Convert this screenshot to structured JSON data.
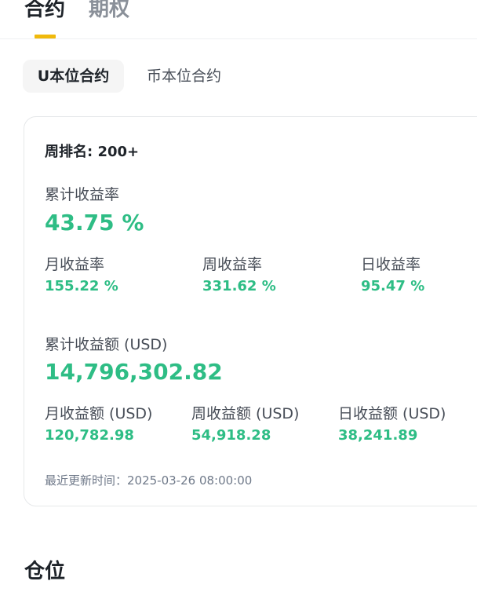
{
  "top_tabs": {
    "active": "合约",
    "inactive": "期权"
  },
  "sub_tabs": {
    "active": "U本位合约",
    "inactive": "币本位合约"
  },
  "card": {
    "rank": "周排名: 200+",
    "cumulative_rate": {
      "label": "累计收益率",
      "value": "43.75 %"
    },
    "rates": [
      {
        "label": "月收益率",
        "value": "155.22 %"
      },
      {
        "label": "周收益率",
        "value": "331.62 %"
      },
      {
        "label": "日收益率",
        "value": "95.47 %"
      }
    ],
    "cumulative_amount": {
      "label": "累计收益额 (USD)",
      "value": "14,796,302.82"
    },
    "amounts": [
      {
        "label": "月收益额 (USD)",
        "value": "120,782.98"
      },
      {
        "label": "周收益额 (USD)",
        "value": "54,918.28"
      },
      {
        "label": "日收益额 (USD)",
        "value": "38,241.89"
      }
    ],
    "updated": "最近更新时间：2025-03-26 08:00:00"
  },
  "section": {
    "title": "仓位"
  },
  "colors": {
    "accent": "#f0b90b",
    "positive": "#2ebd85"
  }
}
